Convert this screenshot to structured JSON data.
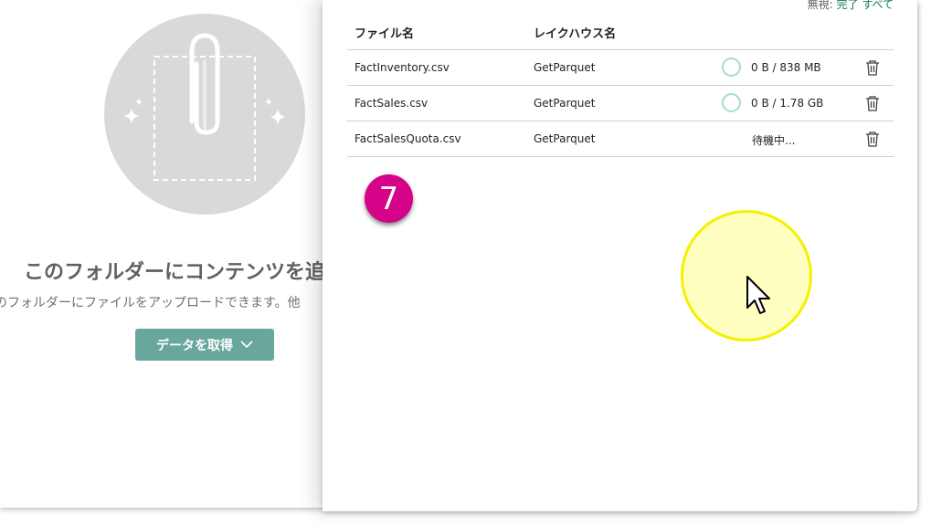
{
  "empty_state": {
    "title": "このフォルダーにコンテンツを追",
    "description": "のフォルダーにファイルをアップロードできます。他",
    "get_data_label": "データを取得"
  },
  "panel": {
    "top_link_prefix": "無視:",
    "top_link_accent": "完了",
    "top_link_suffix": "すべて",
    "columns": {
      "file": "ファイル名",
      "lakehouse": "レイクハウス名"
    },
    "rows": [
      {
        "file": "FactInventory.csv",
        "lakehouse": "GetParquet",
        "status": "0 B / 838 MB",
        "progress": 0
      },
      {
        "file": "FactSales.csv",
        "lakehouse": "GetParquet",
        "status": "0 B / 1.78 GB",
        "progress": 0
      },
      {
        "file": "FactSalesQuota.csv",
        "lakehouse": "GetParquet",
        "status": "待機中...",
        "progress": null
      }
    ]
  },
  "step_badge": "7",
  "colors": {
    "accent": "#69a79c",
    "badge": "#d5038a",
    "ring": "#a6dbd2",
    "highlight": "#ffffc2"
  }
}
